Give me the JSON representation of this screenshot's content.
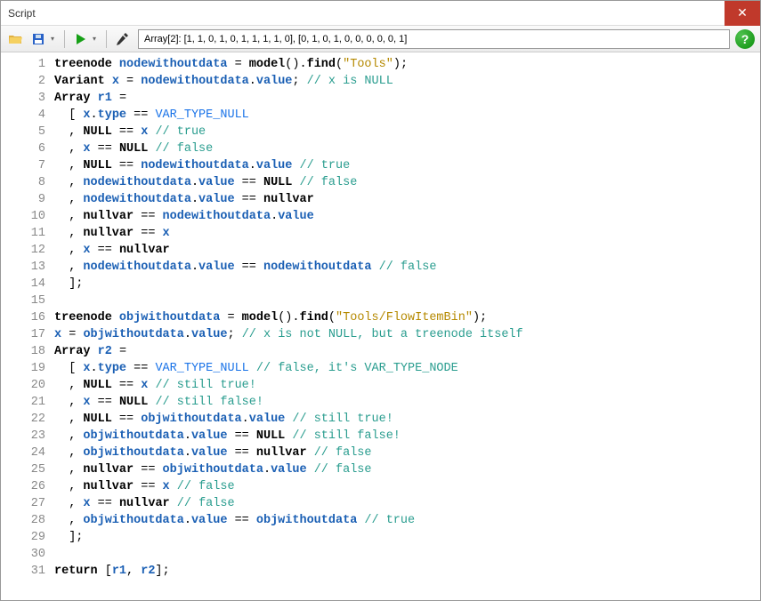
{
  "window": {
    "title": "Script"
  },
  "toolbar": {
    "result": "Array[2]: [1, 1, 0, 1, 0, 1, 1, 1, 1, 0], [0, 1, 0, 1, 0, 0, 0, 0, 0, 1]"
  },
  "code": {
    "lines": [
      {
        "n": 1,
        "seg": [
          [
            "kw",
            "treenode"
          ],
          [
            "plain",
            " "
          ],
          [
            "id",
            "nodewithoutdata"
          ],
          [
            "plain",
            " "
          ],
          [
            "op",
            "="
          ],
          [
            "plain",
            " "
          ],
          [
            "fn",
            "model"
          ],
          [
            "plain",
            "()."
          ],
          [
            "fn",
            "find"
          ],
          [
            "plain",
            "("
          ],
          [
            "str",
            "\"Tools\""
          ],
          [
            "plain",
            ");"
          ]
        ]
      },
      {
        "n": 2,
        "seg": [
          [
            "kw",
            "Variant"
          ],
          [
            "plain",
            " "
          ],
          [
            "id",
            "x"
          ],
          [
            "plain",
            " "
          ],
          [
            "op",
            "="
          ],
          [
            "plain",
            " "
          ],
          [
            "id",
            "nodewithoutdata"
          ],
          [
            "plain",
            "."
          ],
          [
            "id",
            "value"
          ],
          [
            "plain",
            "; "
          ],
          [
            "cm",
            "// x is NULL"
          ]
        ]
      },
      {
        "n": 3,
        "seg": [
          [
            "kw",
            "Array"
          ],
          [
            "plain",
            " "
          ],
          [
            "id",
            "r1"
          ],
          [
            "plain",
            " "
          ],
          [
            "op",
            "="
          ]
        ]
      },
      {
        "n": 4,
        "seg": [
          [
            "plain",
            "  [ "
          ],
          [
            "id",
            "x"
          ],
          [
            "plain",
            "."
          ],
          [
            "id",
            "type"
          ],
          [
            "plain",
            " "
          ],
          [
            "op",
            "=="
          ],
          [
            "plain",
            " "
          ],
          [
            "const",
            "VAR_TYPE_NULL"
          ]
        ]
      },
      {
        "n": 5,
        "seg": [
          [
            "plain",
            "  , "
          ],
          [
            "kw",
            "NULL"
          ],
          [
            "plain",
            " "
          ],
          [
            "op",
            "=="
          ],
          [
            "plain",
            " "
          ],
          [
            "id",
            "x"
          ],
          [
            "plain",
            " "
          ],
          [
            "cm",
            "// true"
          ]
        ]
      },
      {
        "n": 6,
        "seg": [
          [
            "plain",
            "  , "
          ],
          [
            "id",
            "x"
          ],
          [
            "plain",
            " "
          ],
          [
            "op",
            "=="
          ],
          [
            "plain",
            " "
          ],
          [
            "kw",
            "NULL"
          ],
          [
            "plain",
            " "
          ],
          [
            "cm",
            "// false"
          ]
        ]
      },
      {
        "n": 7,
        "seg": [
          [
            "plain",
            "  , "
          ],
          [
            "kw",
            "NULL"
          ],
          [
            "plain",
            " "
          ],
          [
            "op",
            "=="
          ],
          [
            "plain",
            " "
          ],
          [
            "id",
            "nodewithoutdata"
          ],
          [
            "plain",
            "."
          ],
          [
            "id",
            "value"
          ],
          [
            "plain",
            " "
          ],
          [
            "cm",
            "// true"
          ]
        ]
      },
      {
        "n": 8,
        "seg": [
          [
            "plain",
            "  , "
          ],
          [
            "id",
            "nodewithoutdata"
          ],
          [
            "plain",
            "."
          ],
          [
            "id",
            "value"
          ],
          [
            "plain",
            " "
          ],
          [
            "op",
            "=="
          ],
          [
            "plain",
            " "
          ],
          [
            "kw",
            "NULL"
          ],
          [
            "plain",
            " "
          ],
          [
            "cm",
            "// false"
          ]
        ]
      },
      {
        "n": 9,
        "seg": [
          [
            "plain",
            "  , "
          ],
          [
            "id",
            "nodewithoutdata"
          ],
          [
            "plain",
            "."
          ],
          [
            "id",
            "value"
          ],
          [
            "plain",
            " "
          ],
          [
            "op",
            "=="
          ],
          [
            "plain",
            " "
          ],
          [
            "kw",
            "nullvar"
          ]
        ]
      },
      {
        "n": 10,
        "seg": [
          [
            "plain",
            "  , "
          ],
          [
            "kw",
            "nullvar"
          ],
          [
            "plain",
            " "
          ],
          [
            "op",
            "=="
          ],
          [
            "plain",
            " "
          ],
          [
            "id",
            "nodewithoutdata"
          ],
          [
            "plain",
            "."
          ],
          [
            "id",
            "value"
          ]
        ]
      },
      {
        "n": 11,
        "seg": [
          [
            "plain",
            "  , "
          ],
          [
            "kw",
            "nullvar"
          ],
          [
            "plain",
            " "
          ],
          [
            "op",
            "=="
          ],
          [
            "plain",
            " "
          ],
          [
            "id",
            "x"
          ]
        ]
      },
      {
        "n": 12,
        "seg": [
          [
            "plain",
            "  , "
          ],
          [
            "id",
            "x"
          ],
          [
            "plain",
            " "
          ],
          [
            "op",
            "=="
          ],
          [
            "plain",
            " "
          ],
          [
            "kw",
            "nullvar"
          ]
        ]
      },
      {
        "n": 13,
        "seg": [
          [
            "plain",
            "  , "
          ],
          [
            "id",
            "nodewithoutdata"
          ],
          [
            "plain",
            "."
          ],
          [
            "id",
            "value"
          ],
          [
            "plain",
            " "
          ],
          [
            "op",
            "=="
          ],
          [
            "plain",
            " "
          ],
          [
            "id",
            "nodewithoutdata"
          ],
          [
            "plain",
            " "
          ],
          [
            "cm",
            "// false"
          ]
        ]
      },
      {
        "n": 14,
        "seg": [
          [
            "plain",
            "  ];"
          ]
        ]
      },
      {
        "n": 15,
        "seg": [
          [
            "plain",
            ""
          ]
        ]
      },
      {
        "n": 16,
        "seg": [
          [
            "kw",
            "treenode"
          ],
          [
            "plain",
            " "
          ],
          [
            "id",
            "objwithoutdata"
          ],
          [
            "plain",
            " "
          ],
          [
            "op",
            "="
          ],
          [
            "plain",
            " "
          ],
          [
            "fn",
            "model"
          ],
          [
            "plain",
            "()."
          ],
          [
            "fn",
            "find"
          ],
          [
            "plain",
            "("
          ],
          [
            "str",
            "\"Tools/FlowItemBin\""
          ],
          [
            "plain",
            ");"
          ]
        ]
      },
      {
        "n": 17,
        "seg": [
          [
            "id",
            "x"
          ],
          [
            "plain",
            " "
          ],
          [
            "op",
            "="
          ],
          [
            "plain",
            " "
          ],
          [
            "id",
            "objwithoutdata"
          ],
          [
            "plain",
            "."
          ],
          [
            "id",
            "value"
          ],
          [
            "plain",
            "; "
          ],
          [
            "cm",
            "// x is not NULL, but a treenode itself"
          ]
        ]
      },
      {
        "n": 18,
        "seg": [
          [
            "kw",
            "Array"
          ],
          [
            "plain",
            " "
          ],
          [
            "id",
            "r2"
          ],
          [
            "plain",
            " "
          ],
          [
            "op",
            "="
          ]
        ]
      },
      {
        "n": 19,
        "seg": [
          [
            "plain",
            "  [ "
          ],
          [
            "id",
            "x"
          ],
          [
            "plain",
            "."
          ],
          [
            "id",
            "type"
          ],
          [
            "plain",
            " "
          ],
          [
            "op",
            "=="
          ],
          [
            "plain",
            " "
          ],
          [
            "const",
            "VAR_TYPE_NULL"
          ],
          [
            "plain",
            " "
          ],
          [
            "cm",
            "// false, it's VAR_TYPE_NODE"
          ]
        ]
      },
      {
        "n": 20,
        "seg": [
          [
            "plain",
            "  , "
          ],
          [
            "kw",
            "NULL"
          ],
          [
            "plain",
            " "
          ],
          [
            "op",
            "=="
          ],
          [
            "plain",
            " "
          ],
          [
            "id",
            "x"
          ],
          [
            "plain",
            " "
          ],
          [
            "cm",
            "// still true!"
          ]
        ]
      },
      {
        "n": 21,
        "seg": [
          [
            "plain",
            "  , "
          ],
          [
            "id",
            "x"
          ],
          [
            "plain",
            " "
          ],
          [
            "op",
            "=="
          ],
          [
            "plain",
            " "
          ],
          [
            "kw",
            "NULL"
          ],
          [
            "plain",
            " "
          ],
          [
            "cm",
            "// still false!"
          ]
        ]
      },
      {
        "n": 22,
        "seg": [
          [
            "plain",
            "  , "
          ],
          [
            "kw",
            "NULL"
          ],
          [
            "plain",
            " "
          ],
          [
            "op",
            "=="
          ],
          [
            "plain",
            " "
          ],
          [
            "id",
            "objwithoutdata"
          ],
          [
            "plain",
            "."
          ],
          [
            "id",
            "value"
          ],
          [
            "plain",
            " "
          ],
          [
            "cm",
            "// still true!"
          ]
        ]
      },
      {
        "n": 23,
        "seg": [
          [
            "plain",
            "  , "
          ],
          [
            "id",
            "objwithoutdata"
          ],
          [
            "plain",
            "."
          ],
          [
            "id",
            "value"
          ],
          [
            "plain",
            " "
          ],
          [
            "op",
            "=="
          ],
          [
            "plain",
            " "
          ],
          [
            "kw",
            "NULL"
          ],
          [
            "plain",
            " "
          ],
          [
            "cm",
            "// still false!"
          ]
        ]
      },
      {
        "n": 24,
        "seg": [
          [
            "plain",
            "  , "
          ],
          [
            "id",
            "objwithoutdata"
          ],
          [
            "plain",
            "."
          ],
          [
            "id",
            "value"
          ],
          [
            "plain",
            " "
          ],
          [
            "op",
            "=="
          ],
          [
            "plain",
            " "
          ],
          [
            "kw",
            "nullvar"
          ],
          [
            "plain",
            " "
          ],
          [
            "cm",
            "// false"
          ]
        ]
      },
      {
        "n": 25,
        "seg": [
          [
            "plain",
            "  , "
          ],
          [
            "kw",
            "nullvar"
          ],
          [
            "plain",
            " "
          ],
          [
            "op",
            "=="
          ],
          [
            "plain",
            " "
          ],
          [
            "id",
            "objwithoutdata"
          ],
          [
            "plain",
            "."
          ],
          [
            "id",
            "value"
          ],
          [
            "plain",
            " "
          ],
          [
            "cm",
            "// false"
          ]
        ]
      },
      {
        "n": 26,
        "seg": [
          [
            "plain",
            "  , "
          ],
          [
            "kw",
            "nullvar"
          ],
          [
            "plain",
            " "
          ],
          [
            "op",
            "=="
          ],
          [
            "plain",
            " "
          ],
          [
            "id",
            "x"
          ],
          [
            "plain",
            " "
          ],
          [
            "cm",
            "// false"
          ]
        ]
      },
      {
        "n": 27,
        "seg": [
          [
            "plain",
            "  , "
          ],
          [
            "id",
            "x"
          ],
          [
            "plain",
            " "
          ],
          [
            "op",
            "=="
          ],
          [
            "plain",
            " "
          ],
          [
            "kw",
            "nullvar"
          ],
          [
            "plain",
            " "
          ],
          [
            "cm",
            "// false"
          ]
        ]
      },
      {
        "n": 28,
        "seg": [
          [
            "plain",
            "  , "
          ],
          [
            "id",
            "objwithoutdata"
          ],
          [
            "plain",
            "."
          ],
          [
            "id",
            "value"
          ],
          [
            "plain",
            " "
          ],
          [
            "op",
            "=="
          ],
          [
            "plain",
            " "
          ],
          [
            "id",
            "objwithoutdata"
          ],
          [
            "plain",
            " "
          ],
          [
            "cm",
            "// true"
          ]
        ]
      },
      {
        "n": 29,
        "seg": [
          [
            "plain",
            "  ];"
          ]
        ]
      },
      {
        "n": 30,
        "seg": [
          [
            "plain",
            ""
          ]
        ]
      },
      {
        "n": 31,
        "seg": [
          [
            "kw",
            "return"
          ],
          [
            "plain",
            " ["
          ],
          [
            "id",
            "r1"
          ],
          [
            "plain",
            ", "
          ],
          [
            "id",
            "r2"
          ],
          [
            "plain",
            "];"
          ]
        ]
      }
    ]
  }
}
